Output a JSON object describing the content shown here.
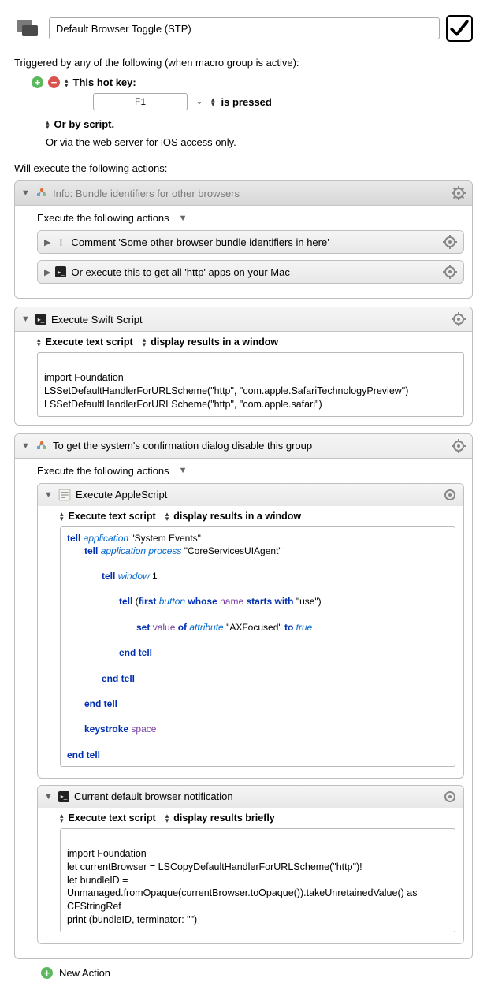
{
  "header": {
    "title": "Default Browser Toggle (STP)"
  },
  "trigger": {
    "triggered_label": "Triggered by any of the following (when macro group is active):",
    "hot_key_label": "This hot key:",
    "hotkey_value": "F1",
    "is_pressed": "is pressed",
    "or_script": "Or by script.",
    "web_server": "Or via the web server for iOS access only."
  },
  "actions_label": "Will execute the following actions:",
  "group_info": {
    "title": "Info: Bundle identifiers for other browsers",
    "exec_label": "Execute the following actions",
    "comment_title": "Comment 'Some other browser bundle identifiers in here'",
    "terminal_title": "Or execute this to get all 'http' apps on your Mac"
  },
  "swift": {
    "title": "Execute Swift Script",
    "opt1": "Execute text script",
    "opt2": "display results in a window",
    "code_line1": "import Foundation",
    "code_line2": "LSSetDefaultHandlerForURLScheme(\"http\", \"com.apple.SafariTechnologyPreview\")",
    "code_line3": "LSSetDefaultHandlerForURLScheme(\"http\", \"com.apple.safari\")"
  },
  "confirm_group": {
    "title": "To get the system's confirmation dialog disable this group",
    "exec_label": "Execute the following actions",
    "applescript": {
      "title": "Execute AppleScript",
      "opt1": "Execute text script",
      "opt2": "display results in a window"
    },
    "notify": {
      "title": "Current default browser notification",
      "opt1": "Execute text script",
      "opt2": "display results briefly",
      "code_line1": "import Foundation",
      "code_line2": "let currentBrowser = LSCopyDefaultHandlerForURLScheme(\"http\")!",
      "code_line3": "let bundleID =",
      "code_line4": "Unmanaged.fromOpaque(currentBrowser.toOpaque()).takeUnretainedValue() as CFStringRef",
      "code_line5": "print (bundleID, terminator: \"\")"
    }
  },
  "applescript_code": {
    "l1a": "tell",
    "l1b": "application",
    "l1c": " \"System Events\"",
    "l2a": "tell",
    "l2b": "application process",
    "l2c": " \"CoreServicesUIAgent\"",
    "l3a": "tell",
    "l3b": "window",
    "l3c": " 1",
    "l4a": "tell",
    "l4b_open": " (",
    "l4c": "first",
    "l4d": "button",
    "l4e": " whose ",
    "l4f": "name",
    "l4g": "starts with",
    "l4h": " \"use\")",
    "l5a": "set",
    "l5b": "value",
    "l5c": " of ",
    "l5d": "attribute",
    "l5e": " \"AXFocused\" ",
    "l5f": "to",
    "l5g": "true",
    "l6": "end tell",
    "l7": "end tell",
    "l8": "end tell",
    "l9a": "keystroke",
    "l9b": "space",
    "l10": "end tell"
  },
  "new_action": "New Action"
}
